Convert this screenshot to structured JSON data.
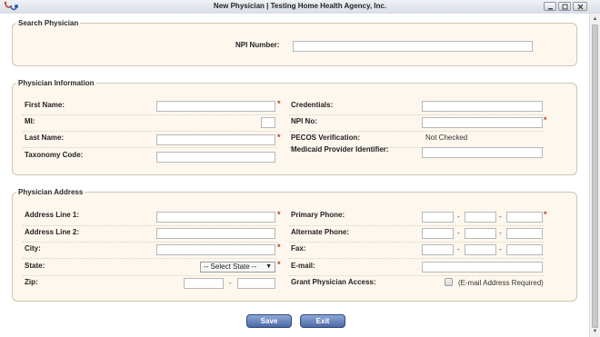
{
  "window": {
    "title": "New Physician | Testing Home Health Agency, Inc."
  },
  "icons": {
    "app": "stethoscope-icon",
    "minimize": "minimize-icon",
    "maximize": "maximize-icon",
    "close": "close-icon"
  },
  "search": {
    "legend": "Search Physician",
    "npi_label": "NPI Number:",
    "npi_value": ""
  },
  "info": {
    "legend": "Physician Information",
    "first_name_label": "First Name:",
    "mi_label": "MI:",
    "last_name_label": "Last Name:",
    "taxonomy_label": "Taxonomy Code:",
    "credentials_label": "Credentials:",
    "npi_no_label": "NPI No:",
    "pecos_label": "PECOS Verification:",
    "pecos_value": "Not Checked",
    "medicaid_label": "Medicaid Provider Identifier:"
  },
  "address": {
    "legend": "Physician Address",
    "line1_label": "Address Line 1:",
    "line2_label": "Address Line 2:",
    "city_label": "City:",
    "state_label": "State:",
    "state_selected": "-- Select State --",
    "zip_label": "Zip:",
    "primary_phone_label": "Primary Phone:",
    "alternate_phone_label": "Alternate Phone:",
    "fax_label": "Fax:",
    "email_label": "E-mail:",
    "grant_access_label": "Grant Physician Access:",
    "email_required_note": "(E-mail Address Required)"
  },
  "actions": {
    "save": "Save",
    "exit": "Exit"
  },
  "colors": {
    "panel_background": "#fdf7ee",
    "panel_border": "#cfc6b3",
    "required_marker": "#c0392b",
    "button_blue": "#4c69a6"
  }
}
